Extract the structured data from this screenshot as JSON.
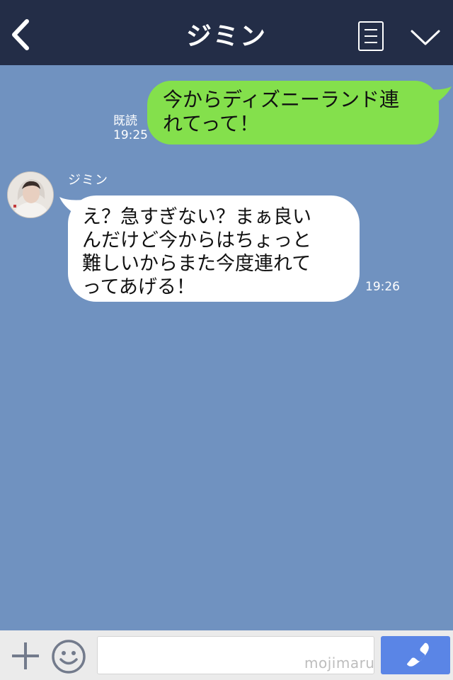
{
  "header": {
    "title": "ジミン",
    "background": "#232d47"
  },
  "messages": {
    "outgoing": {
      "text_line1": "今からディズニーランド連",
      "text_line2": "れてって！",
      "read_status": "既読",
      "time": "19:25",
      "bubble_color": "#84e04c"
    },
    "incoming": {
      "sender": "ジミン",
      "text_line1": "え？急すぎない？まぁ良い",
      "text_line2": "んだけど今からはちょっと",
      "text_line3": "難しいからまた今度連れて",
      "text_line4": "ってあげる！",
      "time": "19:26",
      "bubble_color": "#ffffff"
    }
  },
  "composer": {
    "watermark": "mojimaru",
    "call_button_color": "#5a85e6"
  },
  "icons": {
    "back": "back-chevron-icon",
    "menu": "menu-icon",
    "collapse": "chevron-down-icon",
    "add": "plus-icon",
    "emoji": "smiley-icon",
    "call": "phone-icon"
  },
  "chat_background": "#7092c0"
}
